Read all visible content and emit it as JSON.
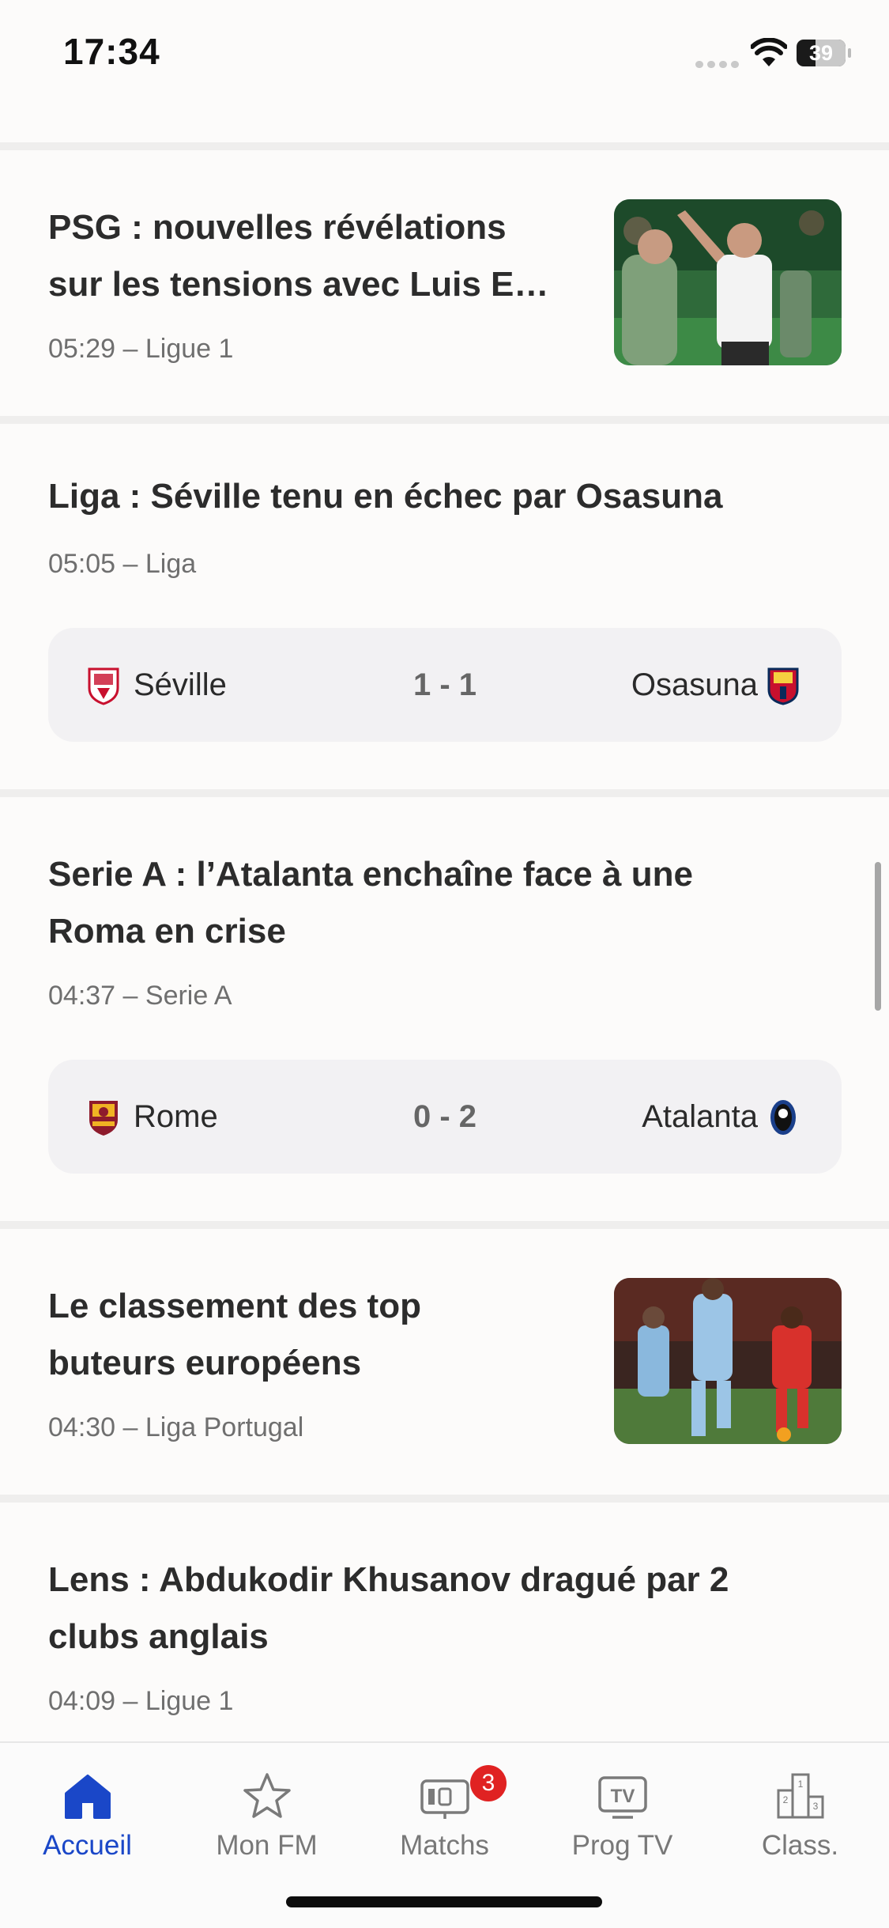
{
  "status_bar": {
    "time": "17:34",
    "battery": "39",
    "battery_level": 0.39
  },
  "articles": [
    {
      "title_lines": [
        "PSG : nouvelles révélations",
        "sur les tensions avec Luis E…"
      ],
      "meta": "05:29 – Ligue 1",
      "thumbnail": "psg-photo"
    },
    {
      "title_lines": [
        "Liga : Séville tenu en échec par Osasuna"
      ],
      "meta": "05:05 – Liga",
      "match": {
        "home": "Séville",
        "score": "1 - 1",
        "away": "Osasuna"
      }
    },
    {
      "title_lines": [
        "Serie A : l’Atalanta enchaîne face à une",
        "Roma en crise"
      ],
      "meta": "04:37 – Serie A",
      "match": {
        "home": "Rome",
        "score": "0 - 2",
        "away": "Atalanta"
      }
    },
    {
      "title_lines": [
        "Le classement des top",
        "buteurs européens"
      ],
      "meta": "04:30 – Liga Portugal",
      "thumbnail": "football-match-photo"
    },
    {
      "title_lines": [
        "Lens : Abdukodir Khusanov dragué par 2",
        "clubs anglais"
      ],
      "meta": "04:09 – Ligue 1"
    }
  ],
  "tab_bar": {
    "tabs": [
      {
        "label": "Accueil",
        "icon": "home-icon",
        "active": true
      },
      {
        "label": "Mon FM",
        "icon": "star-icon"
      },
      {
        "label": "Matchs",
        "icon": "scoreboard-icon",
        "badge": "3"
      },
      {
        "label": "Prog TV",
        "icon": "tv-icon"
      },
      {
        "label": "Class.",
        "icon": "podium-icon"
      }
    ]
  },
  "colors": {
    "accent": "#1a47c8",
    "badge": "#e02222",
    "card": "#f2f1f3"
  }
}
